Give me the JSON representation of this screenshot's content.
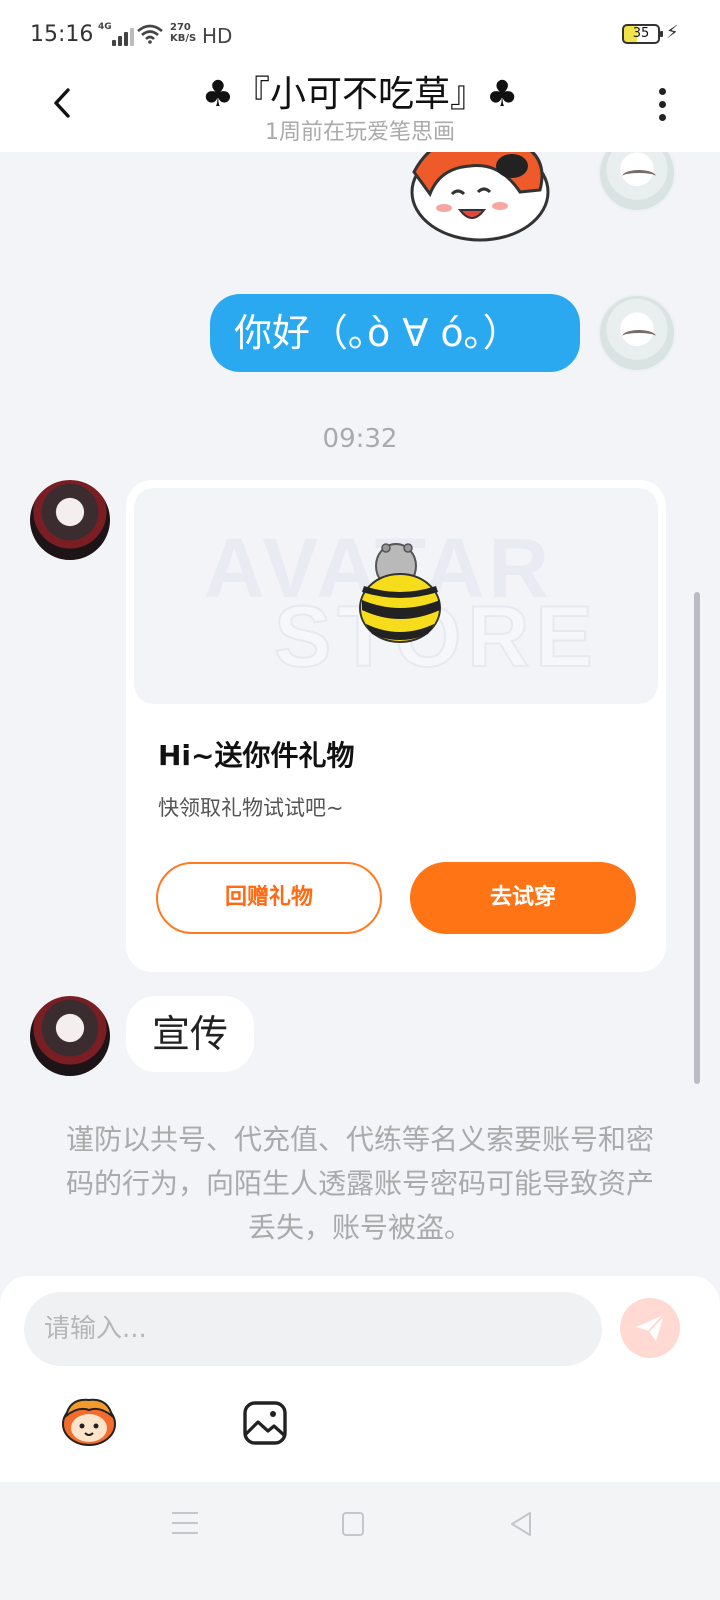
{
  "status_bar": {
    "time": "15:16",
    "network": "4G",
    "speed_value": "270",
    "speed_unit": "KB/S",
    "hd": "HD",
    "battery": "35"
  },
  "header": {
    "title": "♣『小可不吃草』♣",
    "subtitle": "1周前在玩爱笔思画"
  },
  "chat": {
    "my_message": "你好（｡ò ∀ ó｡）",
    "timestamp": "09:32",
    "gift_card": {
      "watermark_line1": "AVATAR",
      "watermark_line2": "STORE",
      "title": "Hi~送你件礼物",
      "description": "快领取礼物试试吧~",
      "return_gift_label": "回赠礼物",
      "try_on_label": "去试穿"
    },
    "their_message": "宣传",
    "security_warning": "谨防以共号、代充值、代练等名义索要账号和密码的行为，向陌生人透露账号密码可能导致资产丢失，账号被盗。"
  },
  "composer": {
    "placeholder": "请输入..."
  },
  "colors": {
    "accent_orange": "#ff7414",
    "bubble_blue": "#2aa9f0",
    "background": "#f3f4f8"
  },
  "icons": [
    "back-icon",
    "more-icon",
    "bee-icon",
    "send-icon",
    "emoji-icon",
    "image-icon",
    "nav-menu-icon",
    "nav-home-icon",
    "nav-back-icon"
  ]
}
